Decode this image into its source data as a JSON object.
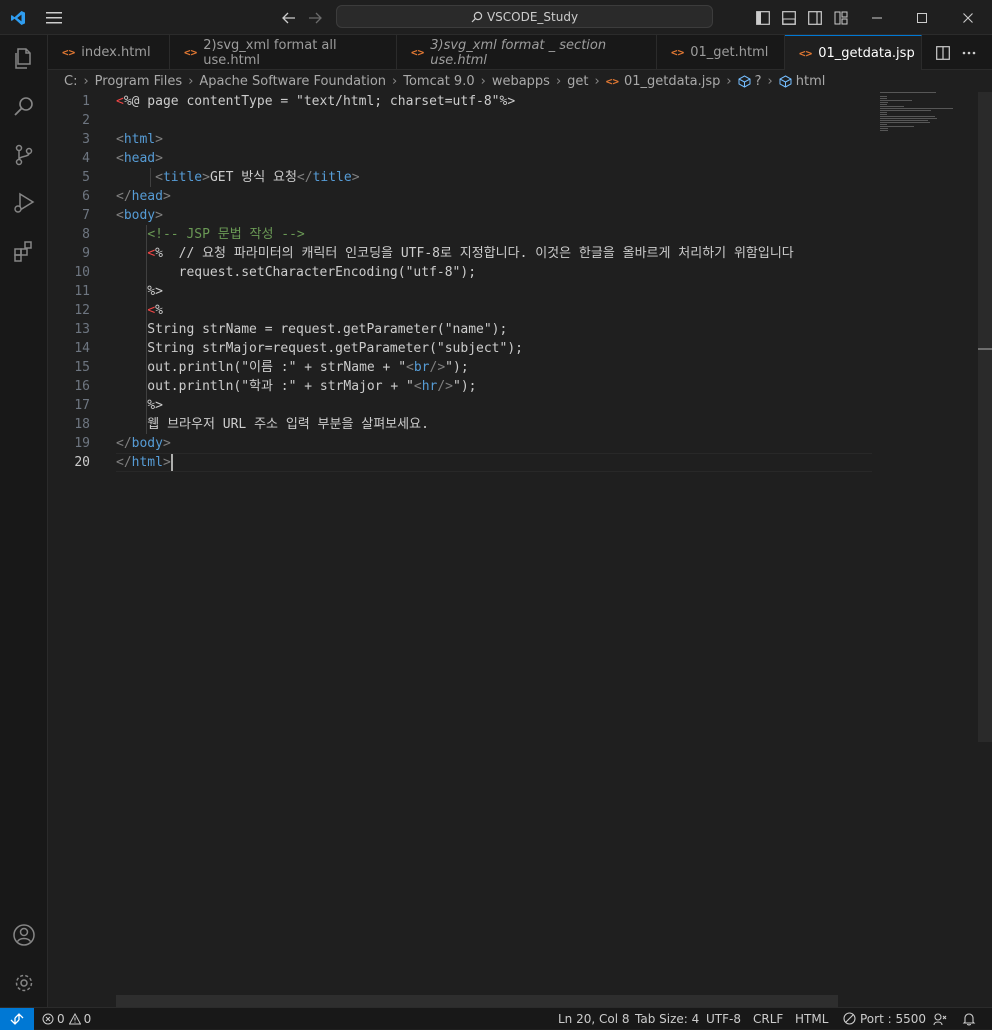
{
  "window": {
    "search_text": "VSCODE_Study",
    "icons": [
      "vscode-logo-icon",
      "menu-icon",
      "back-arrow-icon",
      "forward-arrow-icon",
      "search-icon",
      "toggle-primary-sidebar-icon",
      "toggle-panel-icon",
      "toggle-secondary-sidebar-icon",
      "customize-layout-icon",
      "minimize-icon",
      "maximize-icon",
      "close-icon"
    ]
  },
  "activity_bar": {
    "items": [
      "explorer",
      "search",
      "source-control",
      "run-and-debug",
      "extensions"
    ],
    "bottom": [
      "accounts",
      "manage"
    ]
  },
  "tabs": [
    {
      "label": "index.html",
      "active": false,
      "italic": false
    },
    {
      "label": "2)svg_xml format all use.html",
      "active": false,
      "italic": false
    },
    {
      "label": "3)svg_xml format _ section use.html",
      "active": false,
      "italic": true
    },
    {
      "label": "01_get.html",
      "active": false,
      "italic": false
    },
    {
      "label": "01_getdata.jsp",
      "active": true,
      "italic": false
    }
  ],
  "tab_actions": {
    "split": "split-editor-icon",
    "more": "more-actions-icon"
  },
  "breadcrumb": {
    "parts": [
      "C:",
      "Program Files",
      "Apache Software Foundation",
      "Tomcat 9.0",
      "webapps",
      "get",
      "01_getdata.jsp",
      "?",
      "html"
    ]
  },
  "editor": {
    "current_line": 20,
    "lines": [
      {
        "n": "1",
        "segs": [
          {
            "t": "<",
            "c": "jsp"
          },
          {
            "t": "%@ page contentType = \"text/html; charset=utf-8\"%>",
            "c": "txt"
          }
        ]
      },
      {
        "n": "2",
        "segs": []
      },
      {
        "n": "3",
        "segs": [
          {
            "t": "<",
            "c": "br"
          },
          {
            "t": "html",
            "c": "tag"
          },
          {
            "t": ">",
            "c": "br"
          }
        ]
      },
      {
        "n": "4",
        "segs": [
          {
            "t": "<",
            "c": "br"
          },
          {
            "t": "head",
            "c": "tag"
          },
          {
            "t": ">",
            "c": "br"
          }
        ]
      },
      {
        "n": "5",
        "segs": [
          {
            "t": "     ",
            "c": "txt"
          },
          {
            "t": "<",
            "c": "br"
          },
          {
            "t": "title",
            "c": "tag"
          },
          {
            "t": ">",
            "c": "br"
          },
          {
            "t": "GET 방식 요청",
            "c": "txt"
          },
          {
            "t": "</",
            "c": "br"
          },
          {
            "t": "title",
            "c": "tag"
          },
          {
            "t": ">",
            "c": "br"
          }
        ]
      },
      {
        "n": "6",
        "segs": [
          {
            "t": "</",
            "c": "br"
          },
          {
            "t": "head",
            "c": "tag"
          },
          {
            "t": ">",
            "c": "br"
          }
        ]
      },
      {
        "n": "7",
        "segs": [
          {
            "t": "<",
            "c": "br"
          },
          {
            "t": "body",
            "c": "tag"
          },
          {
            "t": ">",
            "c": "br"
          }
        ]
      },
      {
        "n": "8",
        "segs": [
          {
            "t": "    ",
            "c": "txt"
          },
          {
            "t": "<!-- JSP 문법 작성 -->",
            "c": "cmt"
          }
        ]
      },
      {
        "n": "9",
        "segs": [
          {
            "t": "    ",
            "c": "txt"
          },
          {
            "t": "<",
            "c": "jsp"
          },
          {
            "t": "%  // 요청 파라미터의 캐릭터 인코딩을 UTF-8로 지정합니다. 이것은 한글을 올바르게 처리하기 위함입니다",
            "c": "txt"
          }
        ]
      },
      {
        "n": "10",
        "segs": [
          {
            "t": "        request.setCharacterEncoding(\"utf-8\");",
            "c": "txt"
          }
        ]
      },
      {
        "n": "11",
        "segs": [
          {
            "t": "    %>",
            "c": "txt"
          }
        ]
      },
      {
        "n": "12",
        "segs": [
          {
            "t": "    ",
            "c": "txt"
          },
          {
            "t": "<",
            "c": "jsp"
          },
          {
            "t": "%",
            "c": "txt"
          }
        ]
      },
      {
        "n": "13",
        "segs": [
          {
            "t": "    String strName = request.getParameter(\"name\");",
            "c": "txt"
          }
        ]
      },
      {
        "n": "14",
        "segs": [
          {
            "t": "    String strMajor=request.getParameter(\"subject\");",
            "c": "txt"
          }
        ]
      },
      {
        "n": "15",
        "segs": [
          {
            "t": "    out.println(\"이름 :\" + strName + \"",
            "c": "txt"
          },
          {
            "t": "<",
            "c": "br"
          },
          {
            "t": "br",
            "c": "tag"
          },
          {
            "t": "/>",
            "c": "br"
          },
          {
            "t": "\");",
            "c": "txt"
          }
        ]
      },
      {
        "n": "16",
        "segs": [
          {
            "t": "    out.println(\"학과 :\" + strMajor + \"",
            "c": "txt"
          },
          {
            "t": "<",
            "c": "br"
          },
          {
            "t": "hr",
            "c": "tag"
          },
          {
            "t": "/>",
            "c": "br"
          },
          {
            "t": "\");",
            "c": "txt"
          }
        ]
      },
      {
        "n": "17",
        "segs": [
          {
            "t": "    %>",
            "c": "txt"
          }
        ]
      },
      {
        "n": "18",
        "segs": [
          {
            "t": "    웹 브라우저 URL 주소 입력 부분을 살펴보세요.",
            "c": "txt"
          }
        ]
      },
      {
        "n": "19",
        "segs": [
          {
            "t": "</",
            "c": "br"
          },
          {
            "t": "body",
            "c": "tag"
          },
          {
            "t": ">",
            "c": "br"
          }
        ]
      },
      {
        "n": "20",
        "segs": [
          {
            "t": "</",
            "c": "br"
          },
          {
            "t": "html",
            "c": "tag"
          },
          {
            "t": ">",
            "c": "br"
          }
        ]
      }
    ]
  },
  "statusbar": {
    "problems_errors": "0",
    "problems_warnings": "0",
    "position": "Ln 20, Col 8",
    "tab_size": "Tab Size: 4",
    "encoding": "UTF-8",
    "eol": "CRLF",
    "language": "HTML",
    "port": "Port : 5500"
  },
  "colors": {
    "accent": "#0078d4",
    "tag": "#569cd6",
    "comment": "#6a9955",
    "jsp_delimiter": "#f44747",
    "tab_icon": "#e37933"
  }
}
